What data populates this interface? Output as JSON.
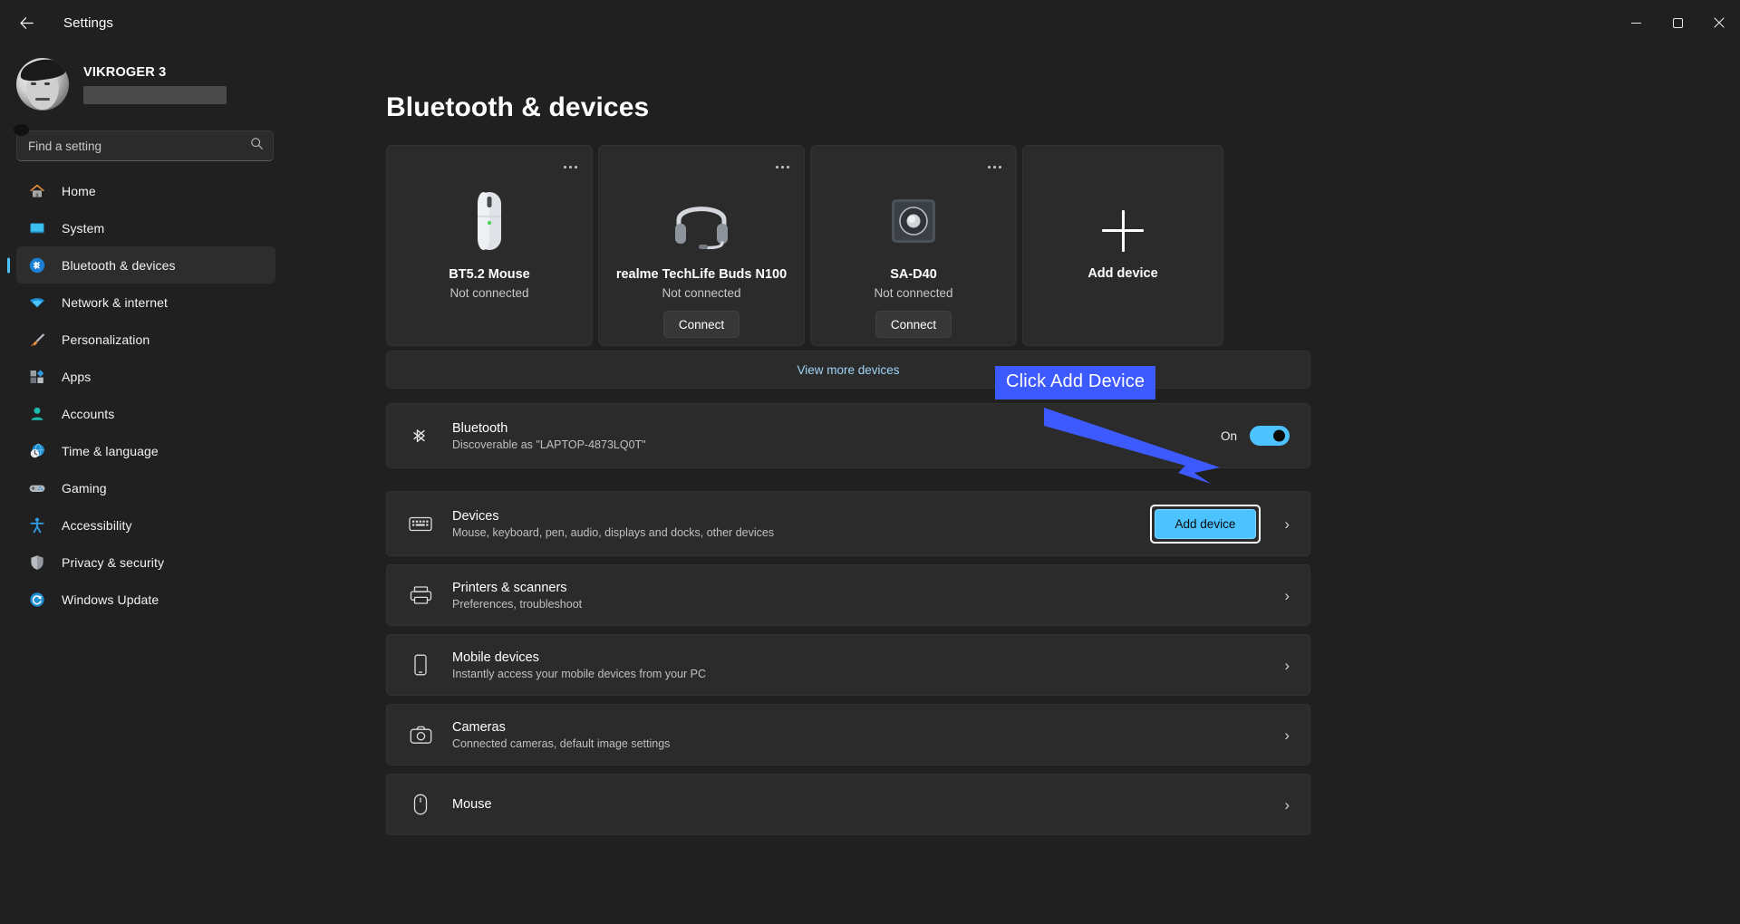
{
  "window": {
    "title": "Settings",
    "back_icon": "back-arrow-icon",
    "minimize_label": "Minimize",
    "maximize_label": "Maximize",
    "close_label": "Close"
  },
  "account": {
    "name": "VIKROGER 3",
    "email_redacted": true
  },
  "search": {
    "placeholder": "Find a setting",
    "icon": "search-icon"
  },
  "sidebar": {
    "items": [
      {
        "label": "Home",
        "icon": "home-icon",
        "active": false
      },
      {
        "label": "System",
        "icon": "system-icon",
        "active": false
      },
      {
        "label": "Bluetooth & devices",
        "icon": "bluetooth-icon",
        "active": true
      },
      {
        "label": "Network & internet",
        "icon": "wifi-icon",
        "active": false
      },
      {
        "label": "Personalization",
        "icon": "paintbrush-icon",
        "active": false
      },
      {
        "label": "Apps",
        "icon": "apps-icon",
        "active": false
      },
      {
        "label": "Accounts",
        "icon": "account-icon",
        "active": false
      },
      {
        "label": "Time & language",
        "icon": "clock-globe-icon",
        "active": false
      },
      {
        "label": "Gaming",
        "icon": "gamepad-icon",
        "active": false
      },
      {
        "label": "Accessibility",
        "icon": "accessibility-icon",
        "active": false
      },
      {
        "label": "Privacy & security",
        "icon": "shield-icon",
        "active": false
      },
      {
        "label": "Windows Update",
        "icon": "update-icon",
        "active": false
      }
    ]
  },
  "page": {
    "title": "Bluetooth & devices"
  },
  "devices": [
    {
      "name": "BT5.2 Mouse",
      "status": "Not connected",
      "icon": "mouse-device-icon",
      "connect_label": "",
      "has_connect": false,
      "more_icon": "more-options-icon"
    },
    {
      "name": "realme TechLife Buds N100",
      "status": "Not connected",
      "icon": "headset-device-icon",
      "connect_label": "Connect",
      "has_connect": true,
      "more_icon": "more-options-icon"
    },
    {
      "name": "SA-D40",
      "status": "Not connected",
      "icon": "speaker-device-icon",
      "connect_label": "Connect",
      "has_connect": true,
      "more_icon": "more-options-icon"
    }
  ],
  "add_device_tile": {
    "label": "Add device",
    "icon": "plus-icon"
  },
  "view_more": {
    "label": "View more devices",
    "color": "#9fd4f5"
  },
  "bluetooth_row": {
    "title": "Bluetooth",
    "subtitle": "Discoverable as \"LAPTOP-4873LQ0T\"",
    "icon": "bluetooth-icon",
    "toggle_label": "On",
    "toggle_on": true,
    "toggle_color": "#4cc2ff"
  },
  "settings_rows": [
    {
      "title": "Devices",
      "subtitle": "Mouse, keyboard, pen, audio, displays and docks, other devices",
      "icon": "devices-icon",
      "action_label": "Add device",
      "has_action": true,
      "chevron": "chevron-right-icon"
    },
    {
      "title": "Printers & scanners",
      "subtitle": "Preferences, troubleshoot",
      "icon": "printer-icon",
      "has_action": false,
      "chevron": "chevron-right-icon"
    },
    {
      "title": "Mobile devices",
      "subtitle": "Instantly access your mobile devices from your PC",
      "icon": "phone-icon",
      "has_action": false,
      "chevron": "chevron-right-icon"
    },
    {
      "title": "Cameras",
      "subtitle": "Connected cameras, default image settings",
      "icon": "camera-icon",
      "has_action": false,
      "chevron": "chevron-right-icon"
    },
    {
      "title": "Mouse",
      "subtitle": "",
      "icon": "mouse-icon",
      "has_action": false,
      "chevron": "chevron-right-icon"
    }
  ],
  "annotation": {
    "text": "Click Add Device",
    "background": "#3d5afe",
    "text_color": "#ffffff"
  }
}
